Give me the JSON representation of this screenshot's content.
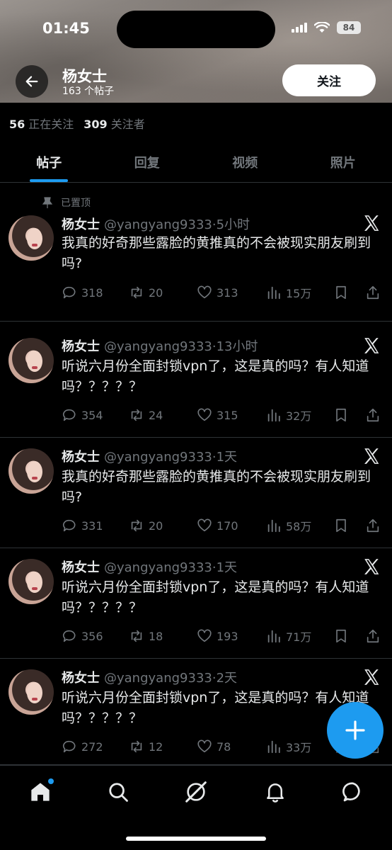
{
  "status_bar": {
    "time": "01:45",
    "battery": "84"
  },
  "header": {
    "name": "杨女士",
    "post_count": "163 个帖子",
    "follow_label": "关注"
  },
  "stats": {
    "following_count": "56",
    "following_label": "正在关注",
    "followers_count": "309",
    "followers_label": "关注者"
  },
  "tabs": [
    {
      "label": "帖子",
      "active": true
    },
    {
      "label": "回复",
      "active": false
    },
    {
      "label": "视频",
      "active": false
    },
    {
      "label": "照片",
      "active": false
    }
  ],
  "pinned_label": "已置顶",
  "posts": [
    {
      "name": "杨女士",
      "handle": "@yangyang9333",
      "time": "·5小时",
      "text": "我真的好奇那些露脸的黄推真的不会被现实朋友刷到吗?",
      "replies": "318",
      "reposts": "20",
      "likes": "313",
      "views": "15万"
    },
    {
      "name": "杨女士",
      "handle": "@yangyang9333",
      "time": "·13小时",
      "text": "听说六月份全面封锁vpn了，这是真的吗？有人知道吗？？？？？",
      "replies": "354",
      "reposts": "24",
      "likes": "315",
      "views": "32万"
    },
    {
      "name": "杨女士",
      "handle": "@yangyang9333",
      "time": "·1天",
      "text": "我真的好奇那些露脸的黄推真的不会被现实朋友刷到吗?",
      "replies": "331",
      "reposts": "20",
      "likes": "170",
      "views": "58万"
    },
    {
      "name": "杨女士",
      "handle": "@yangyang9333",
      "time": "·1天",
      "text": "听说六月份全面封锁vpn了，这是真的吗？有人知道吗？？？？？",
      "replies": "356",
      "reposts": "18",
      "likes": "193",
      "views": "71万"
    },
    {
      "name": "杨女士",
      "handle": "@yangyang9333",
      "time": "·2天",
      "text": "听说六月份全面封锁vpn了，这是真的吗？有人知道吗？？？？？",
      "replies": "272",
      "reposts": "12",
      "likes": "78",
      "views": "33万"
    }
  ],
  "nav": [
    "home-icon",
    "search-icon",
    "grok-icon",
    "notifications-icon",
    "messages-icon"
  ],
  "colors": {
    "accent": "#1d9bf0",
    "muted": "#71767b",
    "text": "#e7e9ea",
    "divider": "#2f3336"
  }
}
